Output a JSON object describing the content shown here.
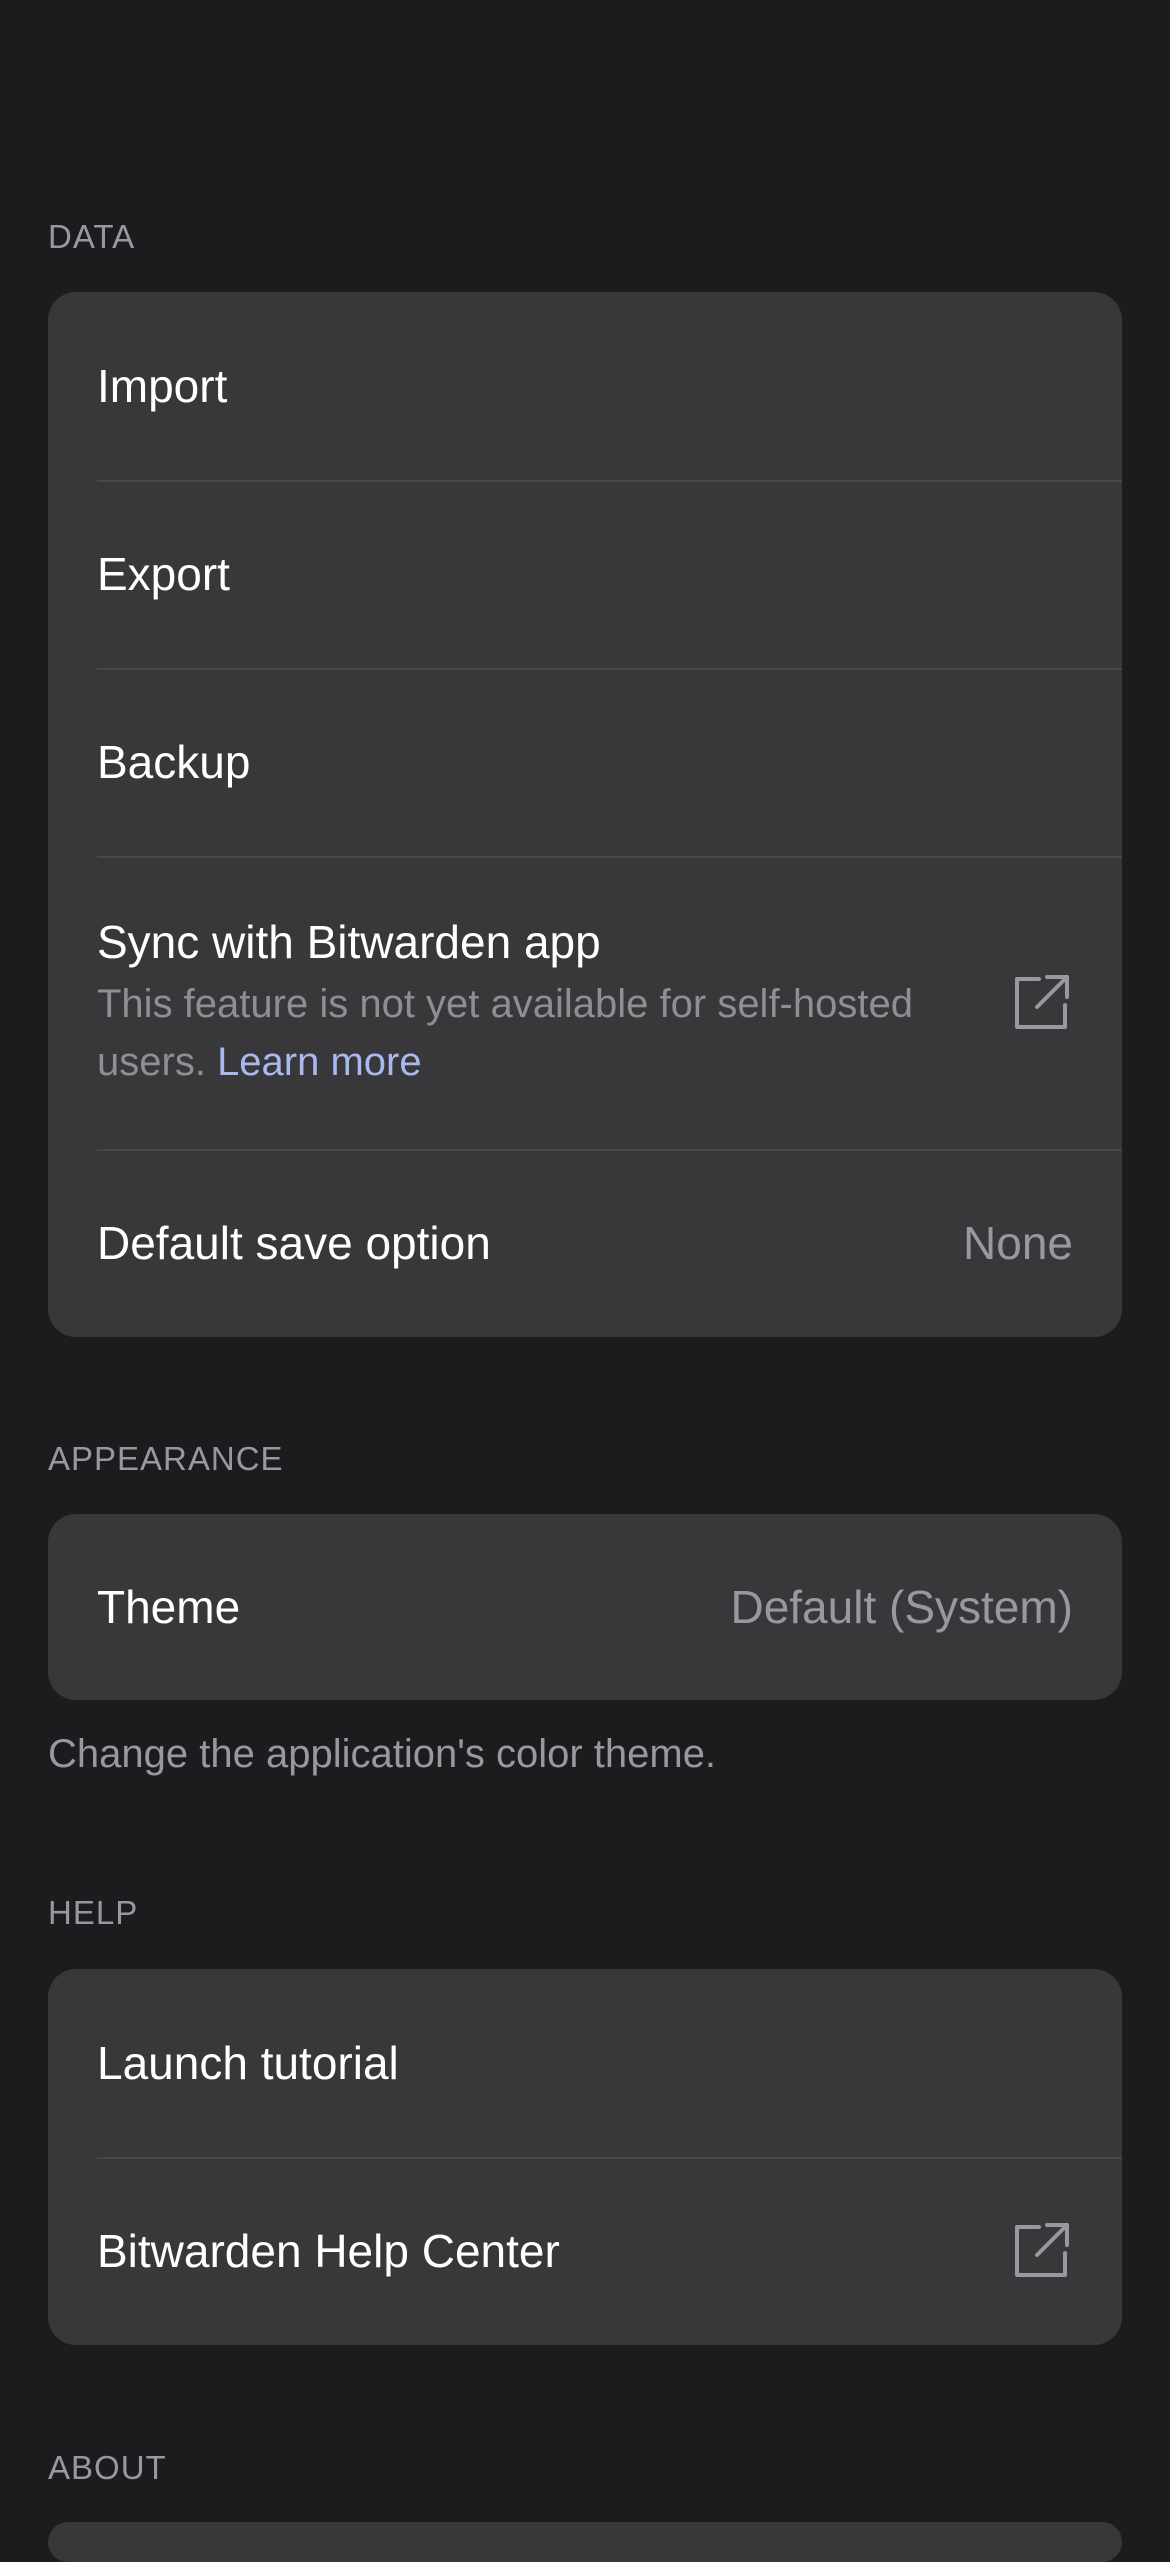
{
  "sections": {
    "data": {
      "header": "DATA",
      "items": [
        {
          "label": "Import"
        },
        {
          "label": "Export"
        },
        {
          "label": "Backup"
        },
        {
          "label": "Sync with Bitwarden app",
          "sub": "This feature is not yet available for self-hosted users.",
          "link": "Learn more",
          "icon": "external-link-icon"
        },
        {
          "label": "Default save option",
          "value": "None"
        }
      ]
    },
    "appearance": {
      "header": "APPEARANCE",
      "items": [
        {
          "label": "Theme",
          "value": "Default (System)"
        }
      ],
      "footer": "Change the application's color theme."
    },
    "help": {
      "header": "HELP",
      "items": [
        {
          "label": "Launch tutorial"
        },
        {
          "label": "Bitwarden Help Center",
          "icon": "external-link-icon"
        }
      ]
    },
    "about": {
      "header": "ABOUT"
    }
  },
  "colors": {
    "background": "#1c1c1e",
    "card": "#38383a",
    "separator": "#48484a",
    "secondary_text": "#98989f",
    "link": "#aab8f0"
  }
}
